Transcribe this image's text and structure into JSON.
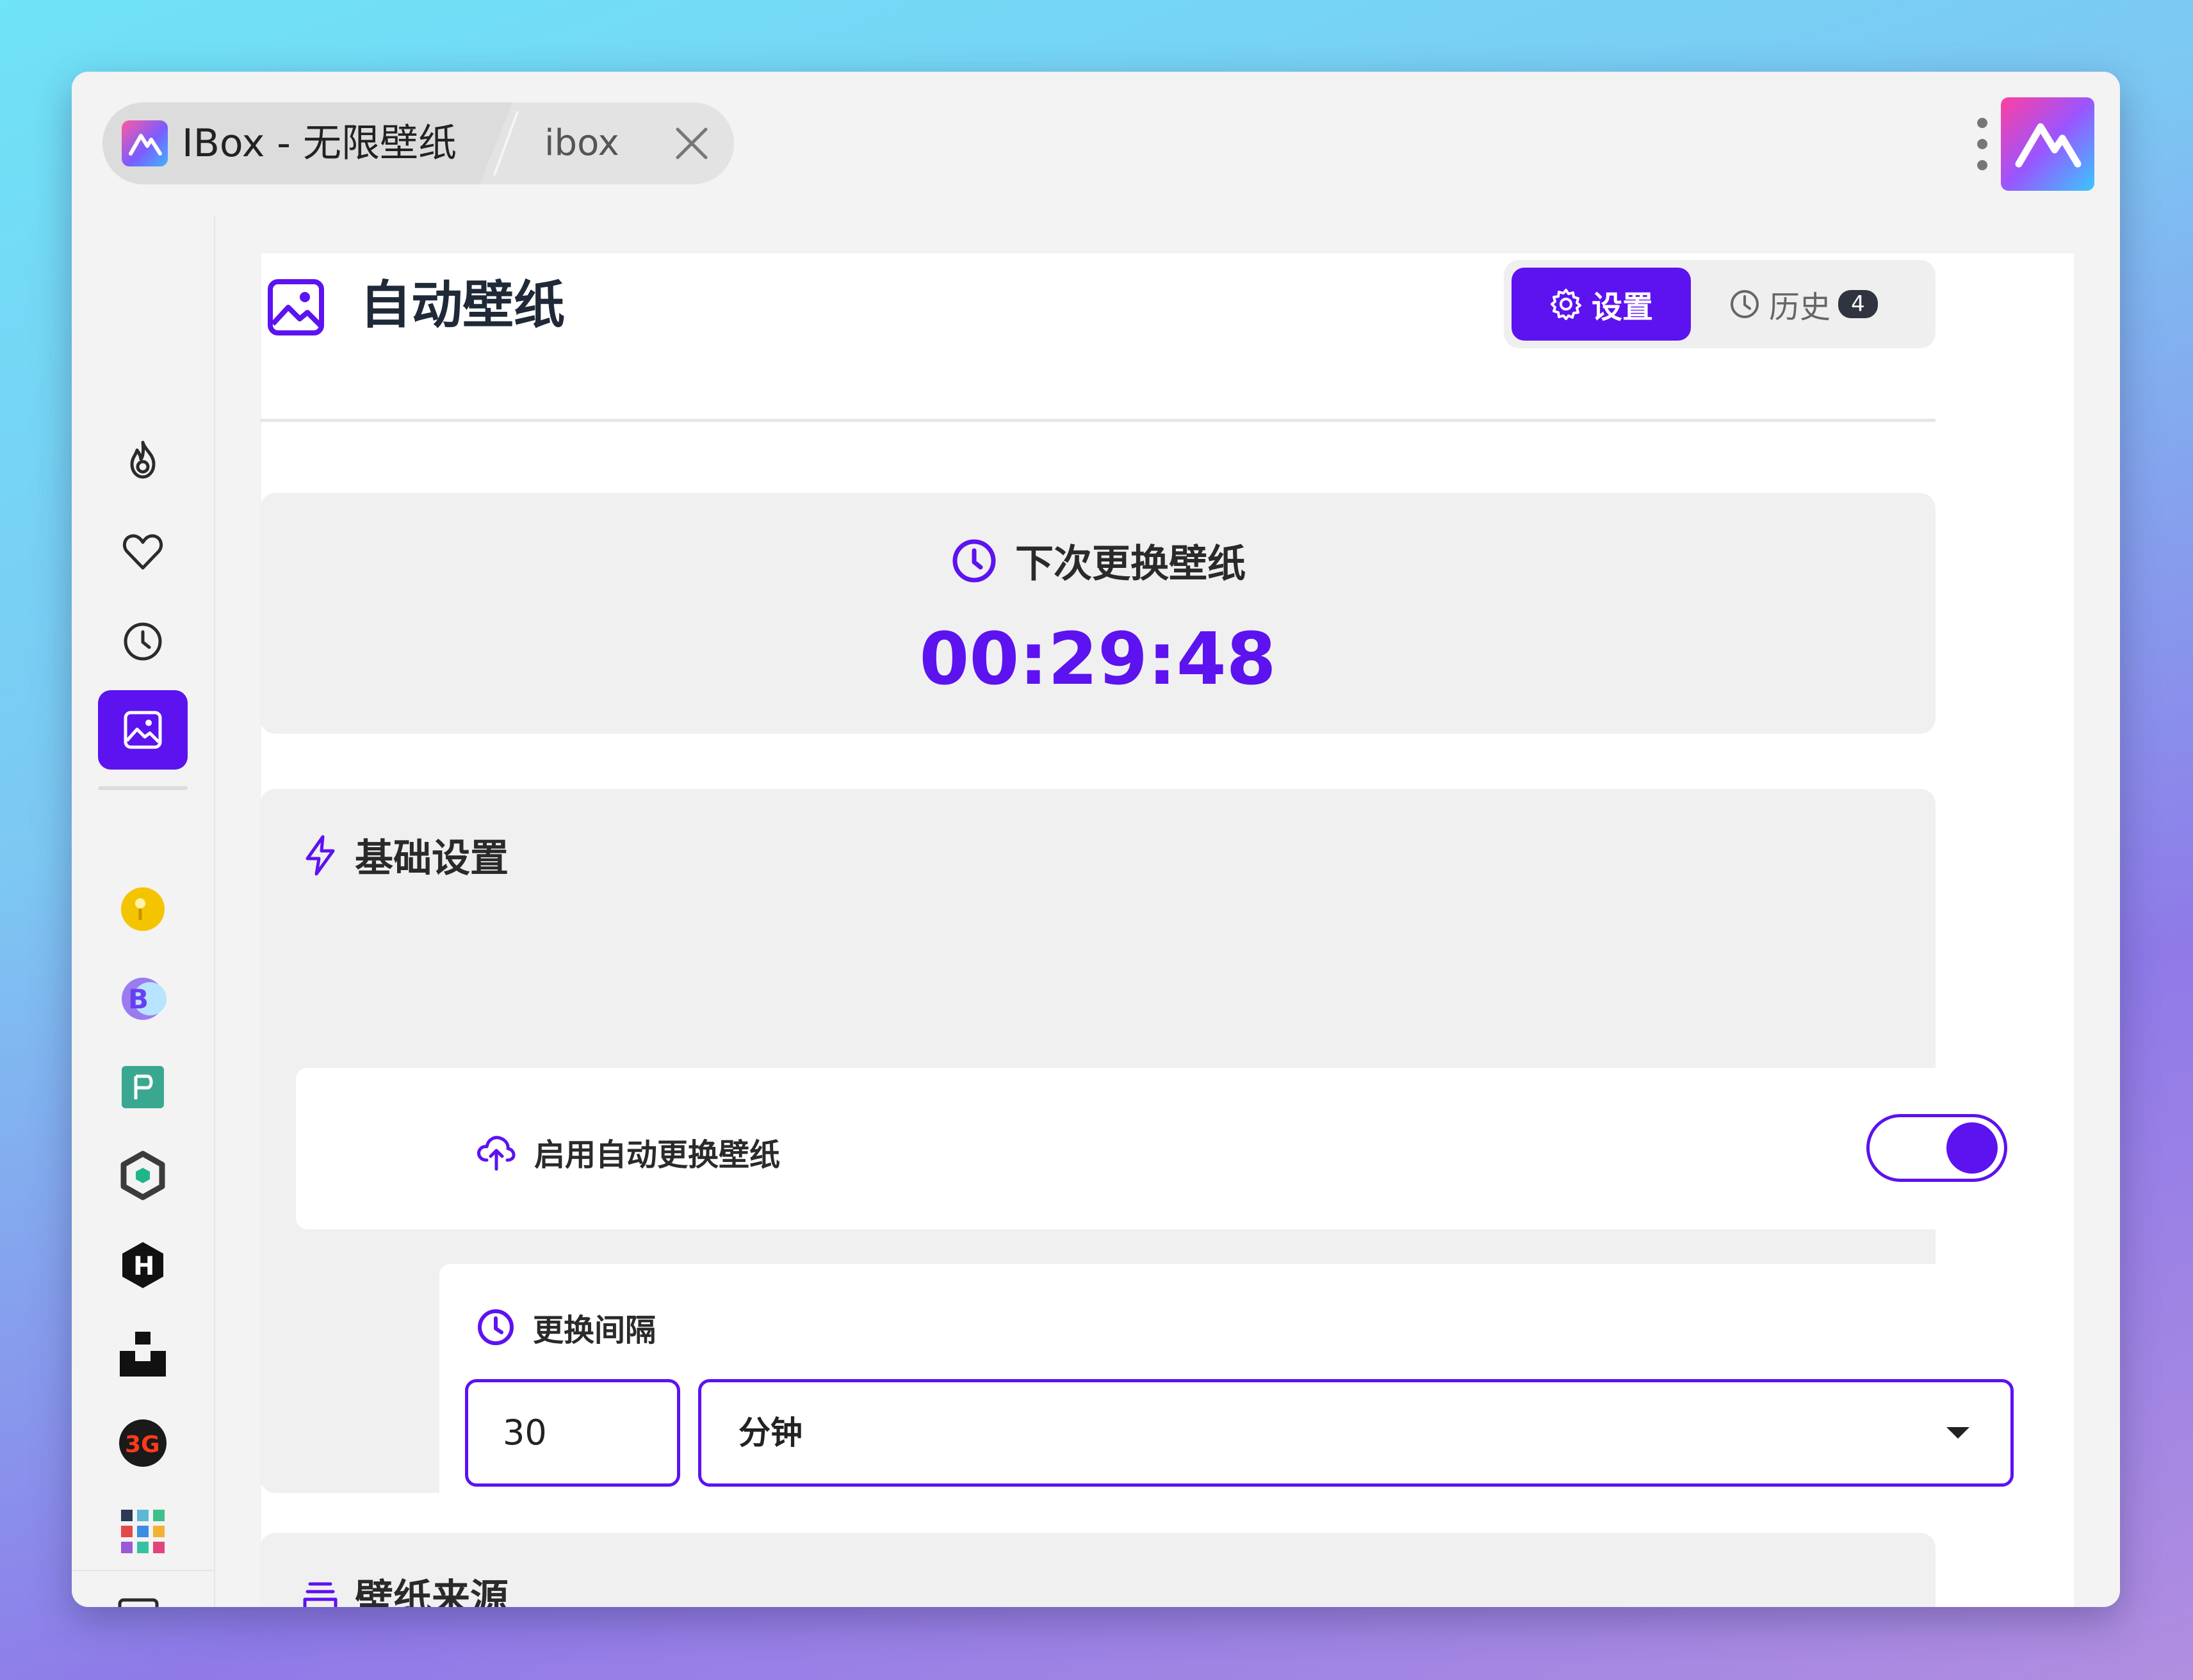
{
  "window": {
    "tab_title": "IBox - 无限壁纸",
    "tab_secondary": "ibox"
  },
  "sidebar": {
    "items": [
      {
        "icon": "fire-icon"
      },
      {
        "icon": "heart-icon"
      },
      {
        "icon": "clock-icon"
      },
      {
        "icon": "image-icon",
        "active": true
      }
    ],
    "sources": [
      {
        "icon": "yellow-source-icon"
      },
      {
        "icon": "purple-b-source-icon"
      },
      {
        "icon": "green-p-source-icon"
      },
      {
        "icon": "hexagon-source-icon"
      },
      {
        "icon": "h-hexagon-source-icon"
      },
      {
        "icon": "unsplash-source-icon"
      },
      {
        "icon": "3g-source-icon"
      },
      {
        "icon": "grid-source-icon"
      }
    ],
    "bottom": {
      "icon": "terminal-icon"
    }
  },
  "page": {
    "title": "自动壁纸",
    "tabs": {
      "settings_label": "设置",
      "history_label": "历史",
      "history_count": "4"
    }
  },
  "countdown": {
    "label": "下次更换壁纸",
    "time": "00:29:48"
  },
  "basic_settings": {
    "title": "基础设置",
    "enable_label": "启用自动更换壁纸",
    "enable_on": true,
    "interval_label": "更换间隔",
    "interval_value": "30",
    "interval_unit": "分钟"
  },
  "wallpaper_source": {
    "title": "壁纸来源"
  },
  "colors": {
    "accent": "#5d12f0"
  }
}
